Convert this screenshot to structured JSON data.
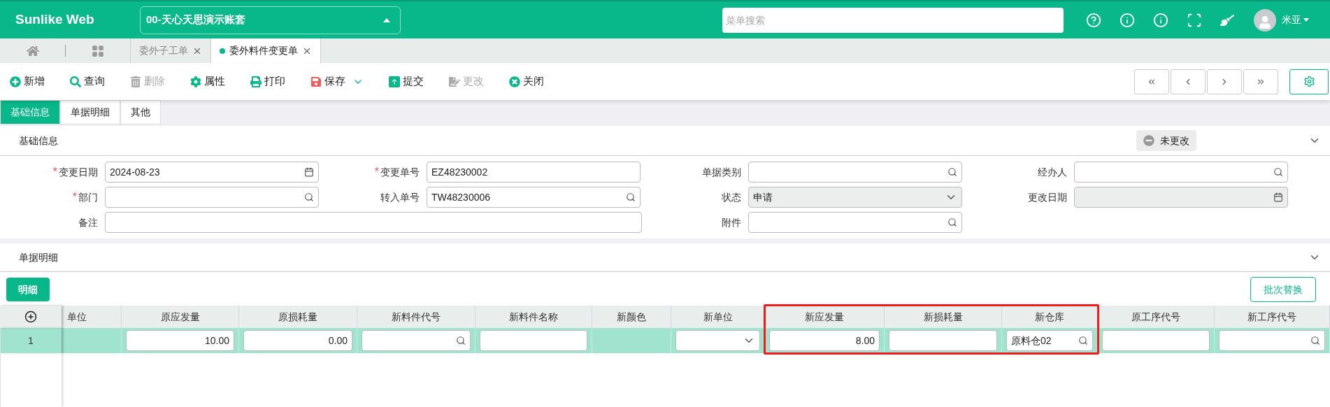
{
  "app": {
    "logo": "Sunlike Web",
    "account": "00-天心天思演示账套",
    "search_placeholder": "菜单搜索",
    "user": "米亚"
  },
  "doc_tabs": [
    {
      "label": "委外子工单",
      "selected": false
    },
    {
      "label": "委外料件变更单",
      "selected": true
    }
  ],
  "toolbar": [
    {
      "label": "新增",
      "disabled": false,
      "dropdown": false
    },
    {
      "label": "查询",
      "disabled": false,
      "dropdown": false
    },
    {
      "label": "删除",
      "disabled": true,
      "dropdown": false
    },
    {
      "label": "属性",
      "disabled": false,
      "dropdown": false
    },
    {
      "label": "打印",
      "disabled": false,
      "dropdown": false
    },
    {
      "label": "保存",
      "disabled": false,
      "dropdown": true
    },
    {
      "label": "提交",
      "disabled": false,
      "dropdown": false
    },
    {
      "label": "更改",
      "disabled": true,
      "dropdown": false
    },
    {
      "label": "关闭",
      "disabled": false,
      "dropdown": false
    }
  ],
  "form_tabs": [
    {
      "label": "基础信息",
      "selected": true
    },
    {
      "label": "单据明细",
      "selected": false
    },
    {
      "label": "其他",
      "selected": false
    }
  ],
  "basic_section": {
    "title": "基础信息",
    "status": "未更改"
  },
  "fields": [
    {
      "label": "变更日期",
      "required_mark": "*",
      "kind": "date",
      "value": "2024-08-23",
      "disabled": false,
      "wide": false
    },
    {
      "label": "变更单号",
      "required_mark": "*",
      "kind": "text",
      "value": "EZ48230002",
      "disabled": false,
      "wide": false
    },
    {
      "label": "单据类别",
      "kind": "lookup",
      "disabled": false,
      "wide": false
    },
    {
      "label": "经办人",
      "kind": "lookup",
      "disabled": false,
      "wide": false
    },
    {
      "label": "部门",
      "required_mark": "*",
      "kind": "lookup",
      "disabled": false,
      "wide": false
    },
    {
      "label": "转入单号",
      "kind": "lookup",
      "value": "TW48230006",
      "disabled": false,
      "wide": false
    },
    {
      "label": "状态",
      "kind": "select",
      "value": "申请",
      "disabled": true,
      "wide": false
    },
    {
      "label": "更改日期",
      "kind": "date",
      "disabled": true,
      "wide": false
    },
    {
      "label": "备注",
      "kind": "text",
      "disabled": false,
      "wide": true
    },
    {
      "label": "附件",
      "kind": "lookup",
      "disabled": false,
      "wide": false
    }
  ],
  "detail_section": {
    "title": "单据明细",
    "tab": "明细",
    "batch_button": "批次替换"
  },
  "table": {
    "columns": [
      {
        "label": "单位",
        "highlighted": false
      },
      {
        "label": "原应发量",
        "highlighted": false
      },
      {
        "label": "原损耗量",
        "highlighted": false
      },
      {
        "label": "新料件代号",
        "highlighted": false
      },
      {
        "label": "新料件名称",
        "highlighted": false
      },
      {
        "label": "新颜色",
        "highlighted": false
      },
      {
        "label": "新单位",
        "highlighted": false
      },
      {
        "label": "新应发量",
        "highlighted": true
      },
      {
        "label": "新损耗量",
        "highlighted": true
      },
      {
        "label": "新仓库",
        "highlighted": true
      },
      {
        "label": "原工序代号",
        "highlighted": false
      },
      {
        "label": "新工序代号",
        "highlighted": false
      }
    ],
    "rows": [
      {
        "index": "1",
        "selected": true,
        "cells": [
          {
            "kind": "blank"
          },
          {
            "kind": "number",
            "value": "10.00"
          },
          {
            "kind": "number",
            "value": "0.00"
          },
          {
            "kind": "lookup"
          },
          {
            "kind": "text"
          },
          {
            "kind": "blank"
          },
          {
            "kind": "select"
          },
          {
            "kind": "number",
            "value": "8.00"
          },
          {
            "kind": "text"
          },
          {
            "kind": "lookup",
            "value": "原料仓02"
          },
          {
            "kind": "text"
          },
          {
            "kind": "lookup"
          }
        ]
      }
    ]
  }
}
